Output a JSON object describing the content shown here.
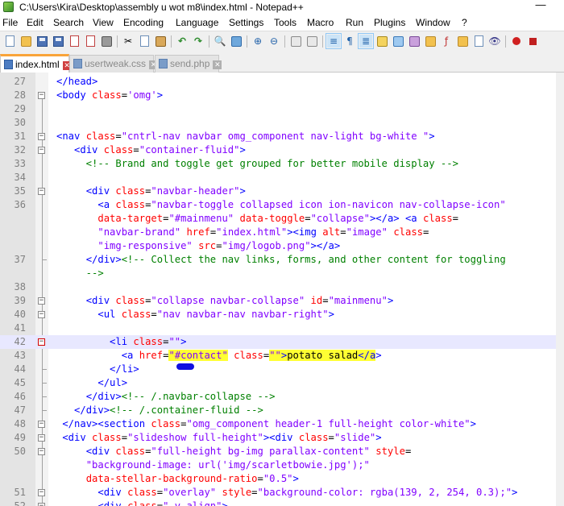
{
  "window": {
    "title": "C:\\Users\\Kira\\Desktop\\assembly u wot m8\\index.html - Notepad++",
    "minimize_glyph": "—"
  },
  "menu": [
    "File",
    "Edit",
    "Search",
    "View",
    "Encoding",
    "Language",
    "Settings",
    "Tools",
    "Macro",
    "Run",
    "Plugins",
    "Window",
    "?"
  ],
  "toolbar": {
    "icons": [
      "new-file",
      "open-file",
      "save",
      "save-all",
      "close",
      "close-all",
      "print",
      "cut",
      "copy",
      "paste",
      "undo",
      "redo",
      "find",
      "replace",
      "zoom-in",
      "zoom-out",
      "sync-vertical",
      "sync-horizontal",
      "word-wrap",
      "show-all-characters",
      "indent-guide",
      "user-language",
      "doc-map",
      "function-list",
      "folder-as-workspace",
      "monitoring",
      "record-macro",
      "stop-recording"
    ]
  },
  "tabs": [
    {
      "label": "index.html",
      "active": true
    },
    {
      "label": "usertweak.css",
      "active": false
    },
    {
      "label": "send.php",
      "active": false
    }
  ],
  "editor": {
    "lines": [
      {
        "num": "27",
        "text": "</head>"
      },
      {
        "num": "28",
        "text": "<body class='omg'>"
      },
      {
        "num": "29",
        "text": ""
      },
      {
        "num": "30",
        "text": ""
      },
      {
        "num": "31",
        "text": "<nav class=\"cntrl-nav navbar omg_component nav-light bg-white \">"
      },
      {
        "num": "32",
        "text": "<div class=\"container-fluid\">"
      },
      {
        "num": "33",
        "text": "<!-- Brand and toggle get grouped for better mobile display -->"
      },
      {
        "num": "34",
        "text": ""
      },
      {
        "num": "35",
        "text": "<div class=\"navbar-header\">"
      },
      {
        "num": "36",
        "text": "<a class=\"navbar-toggle collapsed icon ion-navicon nav-collapse-icon\""
      },
      {
        "num": "",
        "text": "data-target=\"#mainmenu\" data-toggle=\"collapse\"></a> <a class="
      },
      {
        "num": "",
        "text": "\"navbar-brand\" href=\"index.html\"><img alt=\"image\" class="
      },
      {
        "num": "",
        "text": "\"img-responsive\" src=\"img/logob.png\"></a>"
      },
      {
        "num": "37",
        "text": "</div><!-- Collect the nav links, forms, and other content for toggling"
      },
      {
        "num": "",
        "text": "-->"
      },
      {
        "num": "38",
        "text": ""
      },
      {
        "num": "39",
        "text": "<div class=\"collapse navbar-collapse\" id=\"mainmenu\">"
      },
      {
        "num": "40",
        "text": "<ul class=\"nav navbar-nav navbar-right\">"
      },
      {
        "num": "41",
        "text": ""
      },
      {
        "num": "42",
        "text": "<li class=\"\">"
      },
      {
        "num": "43",
        "text": "<a href=\"#contact\" class=\"\">potato salad</a>"
      },
      {
        "num": "44",
        "text": "</li>"
      },
      {
        "num": "45",
        "text": "</ul>"
      },
      {
        "num": "46",
        "text": "</div><!-- /.navbar-collapse -->"
      },
      {
        "num": "47",
        "text": "</div><!-- /.container-fluid -->"
      },
      {
        "num": "48",
        "text": "</nav><section class=\"omg_component header-1 full-height color-white\">"
      },
      {
        "num": "49",
        "text": "<div class=\"slideshow full-height\"><div class=\"slide\">"
      },
      {
        "num": "50",
        "text": "<div class=\"full-height bg-img parallax-content\" style="
      },
      {
        "num": "",
        "text": "\"background-image: url('img/scarletbowie.jpg');\""
      },
      {
        "num": "",
        "text": "data-stellar-background-ratio=\"0.5\">"
      },
      {
        "num": "51",
        "text": "<div class=\"overlay\" style=\"background-color: rgba(139, 2, 254, 0.3);\">"
      },
      {
        "num": "52",
        "text": "<div class=\" v-align\">"
      }
    ]
  },
  "colors": {
    "tag": "#0000ff",
    "attribute": "#ff0000",
    "value": "#8000ff",
    "comment": "#008000",
    "highlight": "#ffff33",
    "active_tab_accent": "#f9a43a"
  }
}
